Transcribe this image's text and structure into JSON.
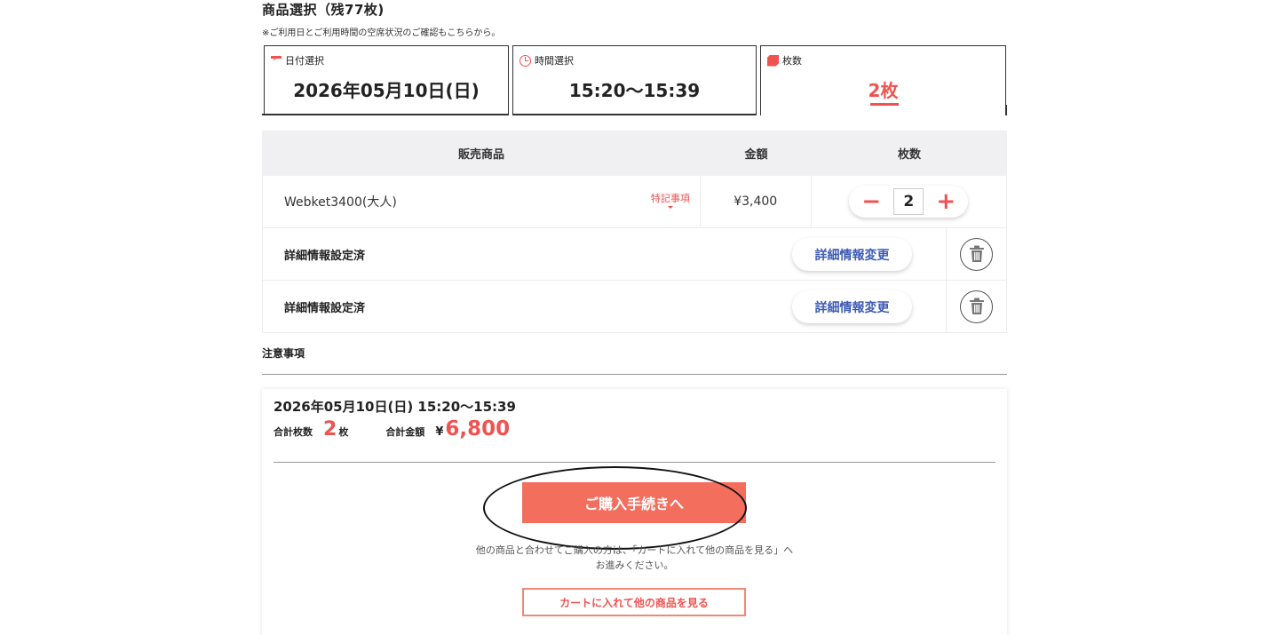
{
  "section": {
    "title": "商品選択（残77枚)",
    "note": "※ご利用日とご利用時間の空席状況のご確認もこちらから。"
  },
  "selectors": {
    "date": {
      "label": "日付選択",
      "value": "2026年05月10日(日)",
      "icon": "calendar-icon"
    },
    "time": {
      "label": "時間選択",
      "value": "15:20〜15:39",
      "icon": "clock-icon"
    },
    "count": {
      "label": "枚数",
      "value": "2枚",
      "icon": "ticket-icon"
    }
  },
  "table": {
    "headers": [
      "販売商品",
      "金額",
      "枚数"
    ],
    "item": {
      "name": "Webket3400(大人)",
      "remark": "特記事項",
      "price": "¥3,400",
      "quantity": "2",
      "minus": "−",
      "plus": "+"
    },
    "details": [
      {
        "label": "詳細情報設定済",
        "button": "詳細情報変更"
      },
      {
        "label": "詳細情報設定済",
        "button": "詳細情報変更"
      }
    ]
  },
  "notice": {
    "title": "注意事項"
  },
  "summary": {
    "datetime": "2026年05月10日(日) 15:20〜15:39",
    "count_label": "合計枚数",
    "count_value": "2",
    "count_unit": "枚",
    "total_label": "合計金額",
    "yen": "¥",
    "total_value": "6,800",
    "purchase_button": "ご購入手続きへ",
    "message_line1": "他の商品と合わせてご購入の方は、「カートに入れて他の商品を見る」へ",
    "message_line2": "お進みください。",
    "cart_button": "カートに入れて他の商品を見る"
  },
  "colors": {
    "accent": "#ef5350",
    "button": "#f46e5e",
    "link": "#3d5bb5"
  }
}
